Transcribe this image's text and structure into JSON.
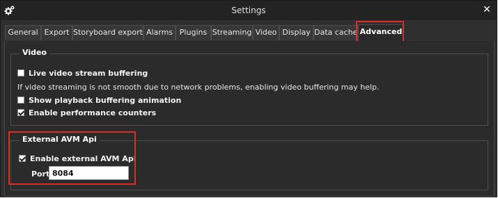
{
  "window": {
    "title": "Settings",
    "app_icon": "gears-icon",
    "close_icon": "close-icon",
    "close_glyph": "✕"
  },
  "tabs": [
    {
      "label": "General"
    },
    {
      "label": "Export"
    },
    {
      "label": "Storyboard export"
    },
    {
      "label": "Alarms"
    },
    {
      "label": "Plugins"
    },
    {
      "label": "Streaming"
    },
    {
      "label": "Video"
    },
    {
      "label": "Display"
    },
    {
      "label": "Data cache"
    },
    {
      "label": "Advanced",
      "active": true
    }
  ],
  "video": {
    "title": "Video",
    "live_buffering": {
      "label": "Live video stream buffering",
      "checked": false
    },
    "hint": "If video streaming is not smooth due to network problems, enabling video buffering may help.",
    "show_playback": {
      "label": "Show playback buffering animation",
      "checked": false
    },
    "perf_counters": {
      "label": "Enable performance counters",
      "checked": true
    }
  },
  "avm": {
    "title": "External AVM Api",
    "enable": {
      "label": "Enable external AVM Api",
      "checked": true
    },
    "port_label": "Port",
    "port_value": "8084"
  },
  "colors": {
    "highlight": "#e02b2b",
    "background": "#2f2f2f"
  }
}
